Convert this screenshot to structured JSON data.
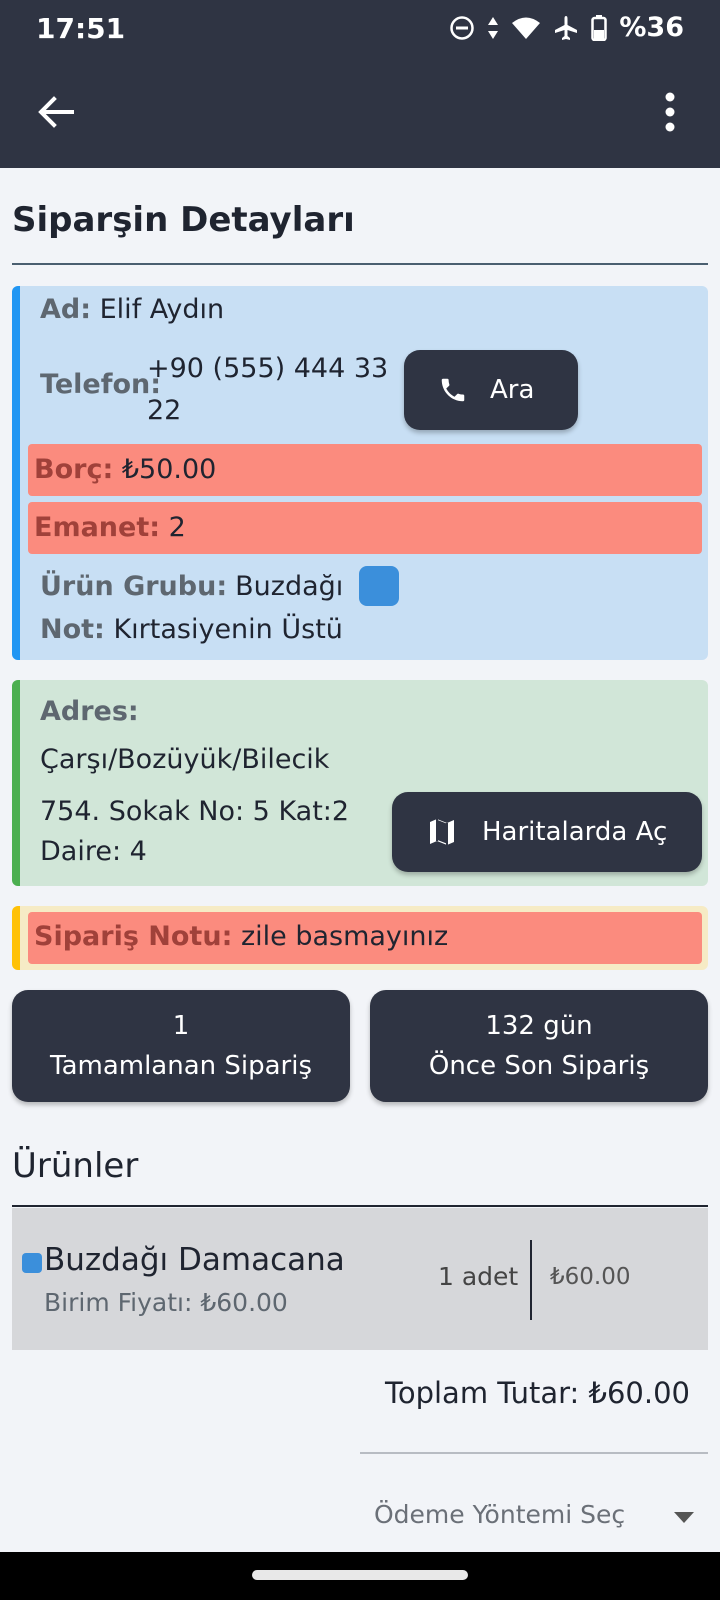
{
  "status_bar": {
    "time": "17:51",
    "battery": "%36"
  },
  "page": {
    "title": "Siparşin Detayları"
  },
  "customer": {
    "name_label": "Ad:",
    "name": "Elif Aydın",
    "phone_label": "Telefon:",
    "phone_line1": "+90 (555) 444 33",
    "phone_line2": "22",
    "call_button": "Ara",
    "debt_label": "Borç:",
    "debt": "₺50.00",
    "deposit_label": "Emanet:",
    "deposit": "2",
    "group_label": "Ürün Grubu:",
    "group": "Buzdağı",
    "group_color": "#3b8fdb",
    "note_label": "Not:",
    "note": "Kırtasiyenin Üstü"
  },
  "address": {
    "label": "Adres:",
    "line1": "Çarşı/Bozüyük/Bilecik",
    "line2": "754. Sokak No: 5 Kat:2",
    "line3": "Daire: 4",
    "map_button": "Haritalarda Aç"
  },
  "order_note": {
    "label": "Sipariş Notu:",
    "text": "zile basmayınız"
  },
  "stats": {
    "completed_count": "1",
    "completed_label": "Tamamlanan Sipariş",
    "last_order_days": "132 gün",
    "last_order_label": "Önce Son Sipariş"
  },
  "products": {
    "title": "Ürünler",
    "items": [
      {
        "name": "Buzdağı Damacana",
        "unit_price": "Birim Fiyatı: ₺60.00",
        "quantity": "1 adet",
        "price": "₺60.00",
        "color": "#3b8fdb"
      }
    ]
  },
  "total": "Toplam Tutar: ₺60.00",
  "payment": {
    "placeholder": "Ödeme Yöntemi Seç"
  },
  "colors": {
    "primary_dark": "#2f3443",
    "alert_red": "#fb8b7e",
    "info_blue": "#2196f3",
    "success_green": "#4caf50",
    "warning_yellow": "#ffc107"
  }
}
